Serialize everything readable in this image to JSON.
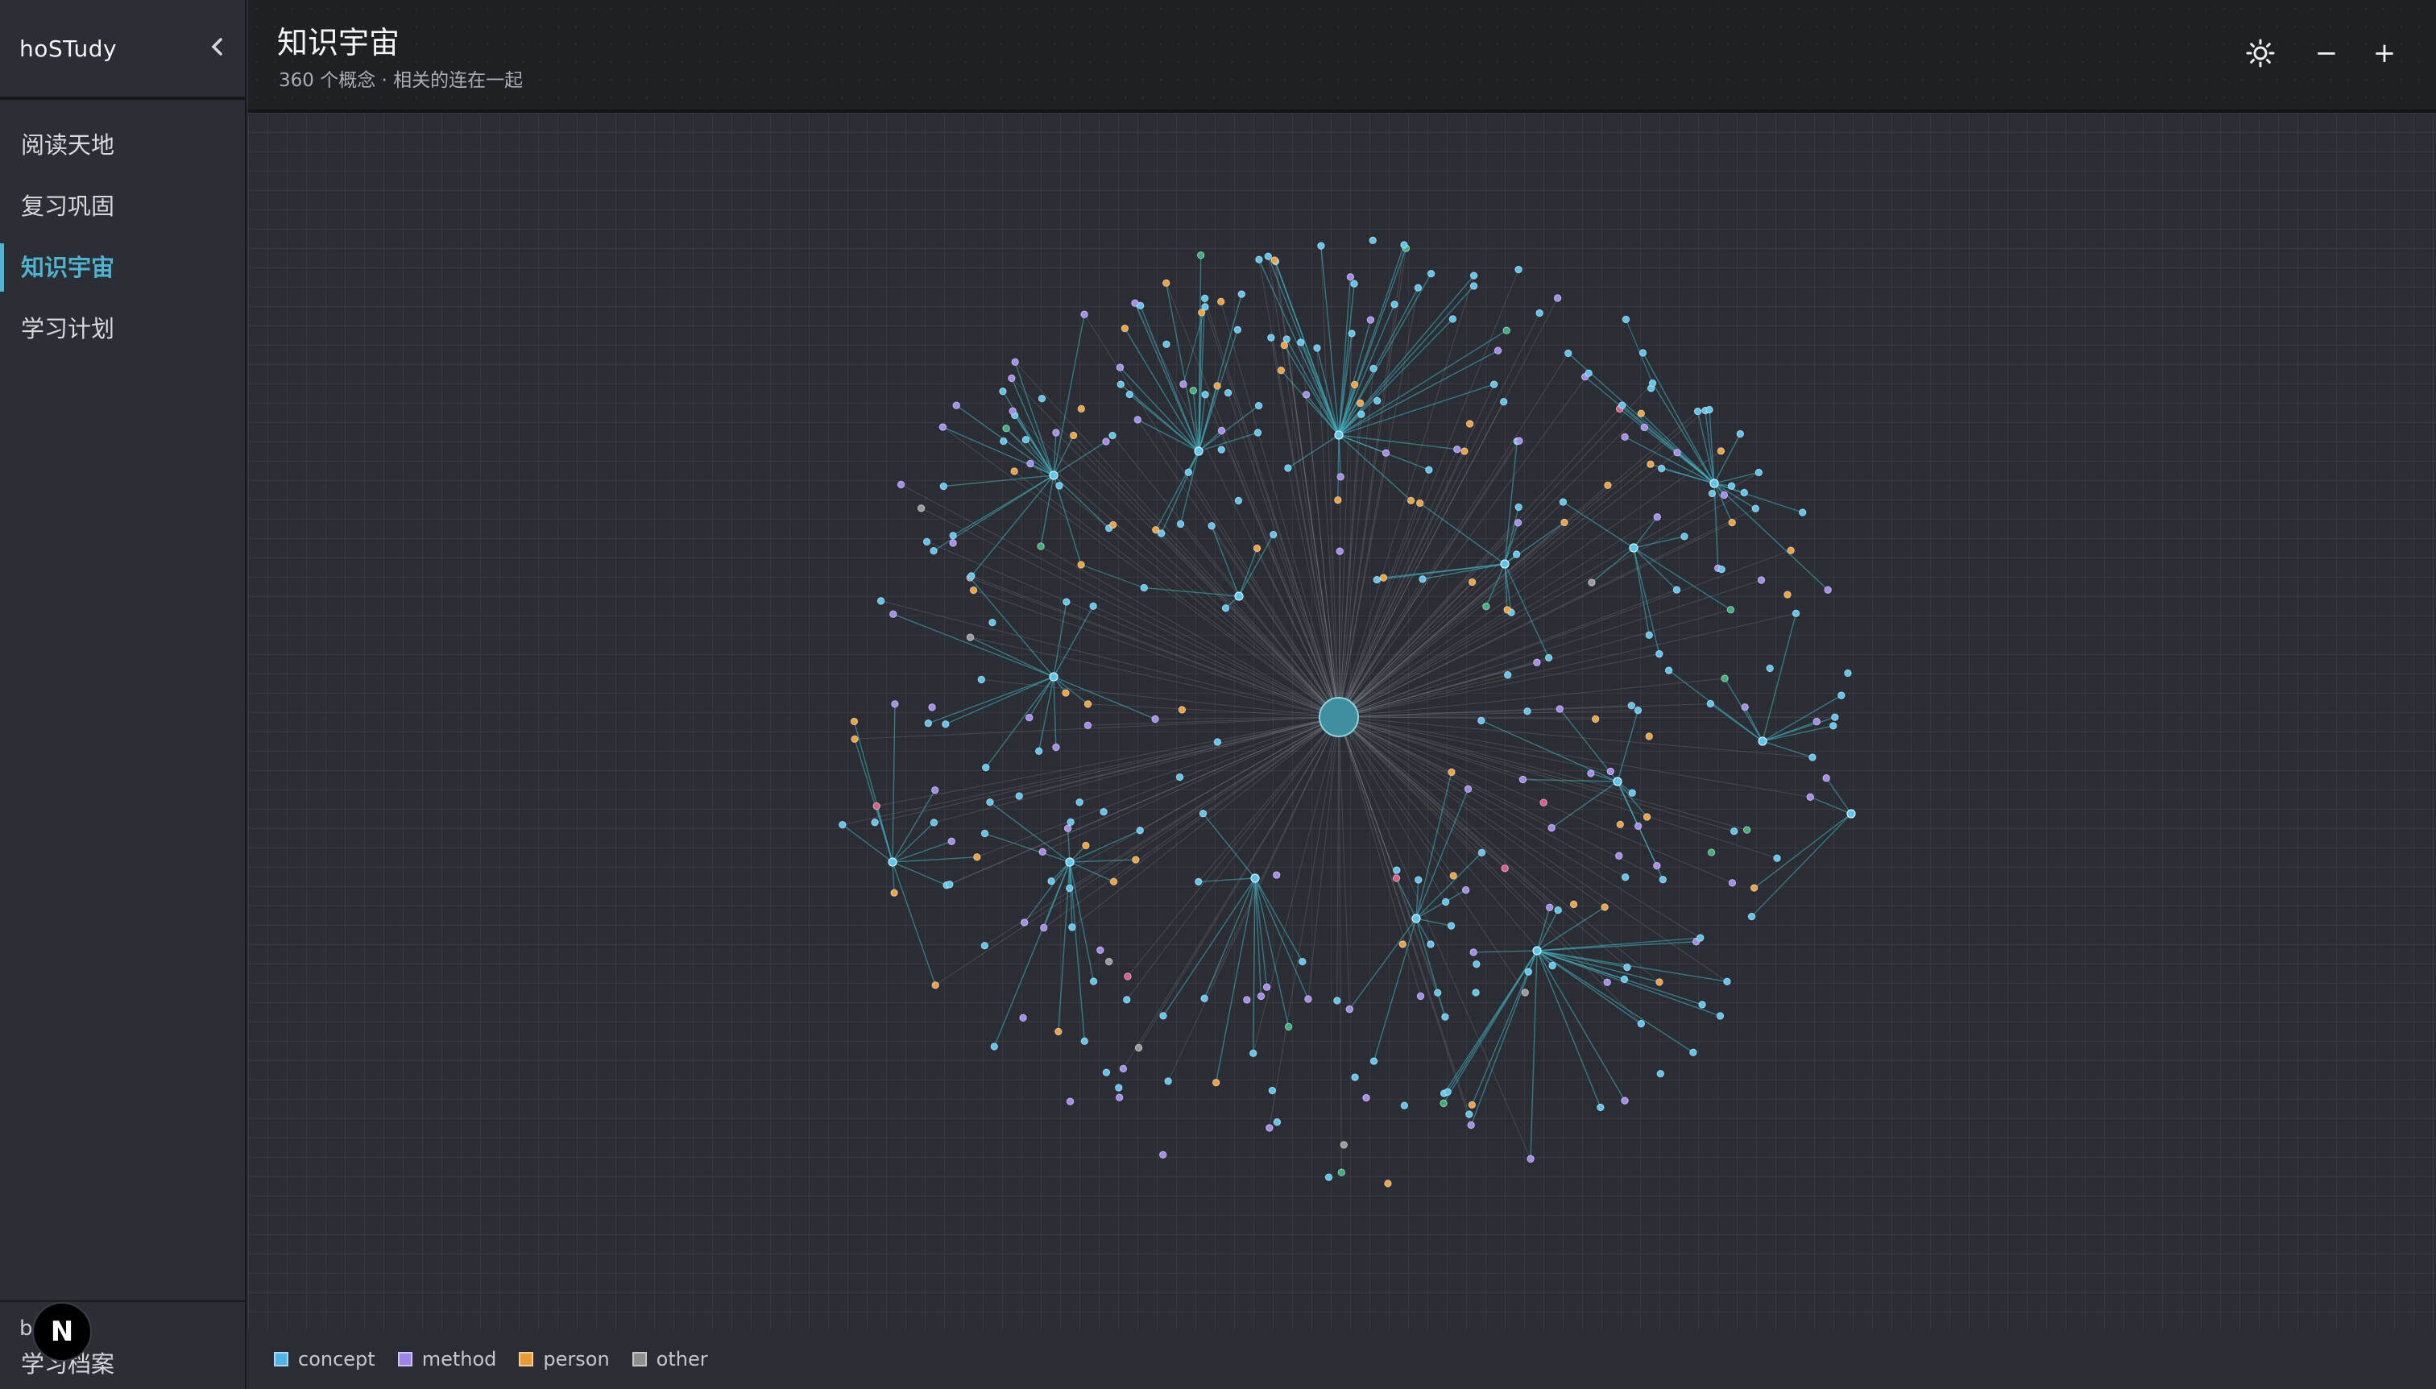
{
  "app": {
    "brand": "hoSTudy"
  },
  "sidebar": {
    "collapse_icon": "chevron-left-icon",
    "items": [
      {
        "label": "阅读天地",
        "active": false
      },
      {
        "label": "复习巩固",
        "active": false
      },
      {
        "label": "知识宇宙",
        "active": true
      },
      {
        "label": "学习计划",
        "active": false
      }
    ],
    "footer_small": "b",
    "footer_link": "学习档案",
    "badge_letter": "N"
  },
  "header": {
    "title": "知识宇宙",
    "subtitle": "360 个概念 · 相关的连在一起",
    "buttons": [
      {
        "name": "theme-toggle-button",
        "icon": "sun-icon"
      },
      {
        "name": "zoom-out-button",
        "label": "−"
      },
      {
        "name": "zoom-in-button",
        "label": "+"
      }
    ]
  },
  "graph": {
    "node_count": 360,
    "colors": {
      "concept": "#5cc6ef",
      "method": "#a58bf0",
      "person": "#f0a23c",
      "other": "#9a9a9a",
      "green": "#3ab27a",
      "pink": "#e05a8a",
      "hub": "#3f8fa0",
      "edge": "#43b6c6"
    }
  },
  "legend": [
    {
      "label": "concept",
      "color": "#4fb3e8"
    },
    {
      "label": "method",
      "color": "#9d85e8"
    },
    {
      "label": "person",
      "color": "#e79a35"
    },
    {
      "label": "other",
      "color": "#8e8e8e"
    }
  ]
}
